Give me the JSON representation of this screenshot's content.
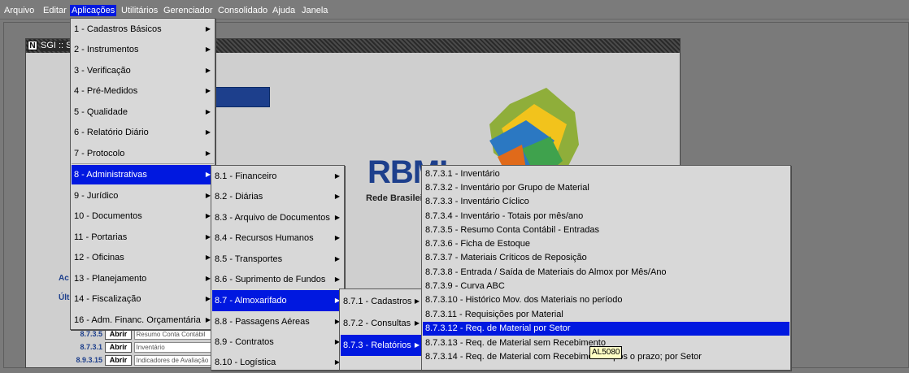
{
  "menubar": {
    "items": [
      "Arquivo",
      "Editar",
      "Aplicações",
      "Utilitários",
      "Gerenciador",
      "Consolidado",
      "Ajuda",
      "Janela"
    ],
    "active_index": 2
  },
  "window": {
    "title": "SGI :: S",
    "icon_letter": "N"
  },
  "logo": {
    "text": "RBMLQ",
    "subtitle": "Rede Brasileira"
  },
  "side_labels": [
    "Ac",
    "Últ"
  ],
  "shortcuts": [
    {
      "code": "8.7.3.5",
      "button": "Abrir",
      "desc": "Resumo Conta Contábil"
    },
    {
      "code": "8.7.3.1",
      "button": "Abrir",
      "desc": "Inventário"
    },
    {
      "code": "8.9.3.15",
      "button": "Abrir",
      "desc": "Indicadores de Avaliação"
    }
  ],
  "menu_aplicacoes": [
    {
      "label": "1 - Cadastros Básicos",
      "arrow": "▶"
    },
    {
      "label": "2 - Instrumentos",
      "arrow": "▶"
    },
    {
      "label": "3 - Verificação",
      "arrow": "▶"
    },
    {
      "label": "4 - Pré-Medidos",
      "arrow": "▶"
    },
    {
      "label": "5 - Qualidade",
      "arrow": "▶"
    },
    {
      "label": "6 - Relatório Diário",
      "arrow": "▶"
    },
    {
      "label": "7 - Protocolo",
      "arrow": "▶"
    },
    {
      "label": "8 - Administrativas",
      "arrow": "▶",
      "highlight": true
    },
    {
      "label": "9 - Jurídico",
      "arrow": "▶"
    },
    {
      "label": "10 - Documentos",
      "arrow": "▶"
    },
    {
      "label": "11 - Portarias",
      "arrow": "▶"
    },
    {
      "label": "12 - Oficinas",
      "arrow": "▶"
    },
    {
      "label": "13 - Planejamento",
      "arrow": "▶"
    },
    {
      "label": "14 - Fiscalização",
      "arrow": "▶"
    },
    {
      "label": "16 - Adm. Financ. Orçamentária",
      "arrow": "▶"
    }
  ],
  "menu_administrativas": [
    {
      "label": "8.1 - Financeiro",
      "arrow": "▶"
    },
    {
      "label": "8.2 - Diárias",
      "arrow": "▶"
    },
    {
      "label": "8.3 - Arquivo de Documentos",
      "arrow": "▶"
    },
    {
      "label": "8.4 - Recursos Humanos",
      "arrow": "▶"
    },
    {
      "label": "8.5 - Transportes",
      "arrow": "▶"
    },
    {
      "label": "8.6 - Suprimento de Fundos",
      "arrow": "▶"
    },
    {
      "label": "8.7 - Almoxarifado",
      "arrow": "▶",
      "highlight": true
    },
    {
      "label": "8.8 - Passagens Aéreas",
      "arrow": "▶"
    },
    {
      "label": "8.9 - Contratos",
      "arrow": "▶"
    },
    {
      "label": "8.10 - Logística",
      "arrow": "▶"
    }
  ],
  "menu_almoxarifado": [
    {
      "label": "8.7.1 - Cadastros",
      "arrow": "▶"
    },
    {
      "label": "8.7.2 - Consultas",
      "arrow": "▶"
    },
    {
      "label": "8.7.3 - Relatórios",
      "arrow": "▶",
      "highlight": true
    }
  ],
  "menu_relatorios": [
    {
      "label": "8.7.3.1 - Inventário"
    },
    {
      "label": "8.7.3.2 - Inventário por Grupo de Material"
    },
    {
      "label": "8.7.3.3 - Inventário Cíclico"
    },
    {
      "label": "8.7.3.4 - Inventário - Totais por mês/ano"
    },
    {
      "label": "8.7.3.5 - Resumo Conta Contábil - Entradas"
    },
    {
      "label": "8.7.3.6 - Ficha de Estoque"
    },
    {
      "label": "8.7.3.7 - Materiais Críticos de Reposição"
    },
    {
      "label": "8.7.3.8 - Entrada / Saída de Materiais do Almox por Mês/Ano"
    },
    {
      "label": "8.7.3.9 - Curva ABC"
    },
    {
      "label": "8.7.3.10 - Histórico Mov. dos Materiais no período"
    },
    {
      "label": "8.7.3.11 - Requisições por Material"
    },
    {
      "label": "8.7.3.12 - Req. de Material por Setor",
      "highlight": true
    },
    {
      "label": "8.7.3.13 - Req. de Material sem Recebimento"
    },
    {
      "label": "8.7.3.14 - Req. de Material com Recebimento após o prazo; por Setor"
    }
  ],
  "tooltip": "AL5080",
  "colors": {
    "highlight": "#0018e0",
    "menu_bg": "#d8d8d8",
    "logo_blue": "#1d3f8c"
  }
}
